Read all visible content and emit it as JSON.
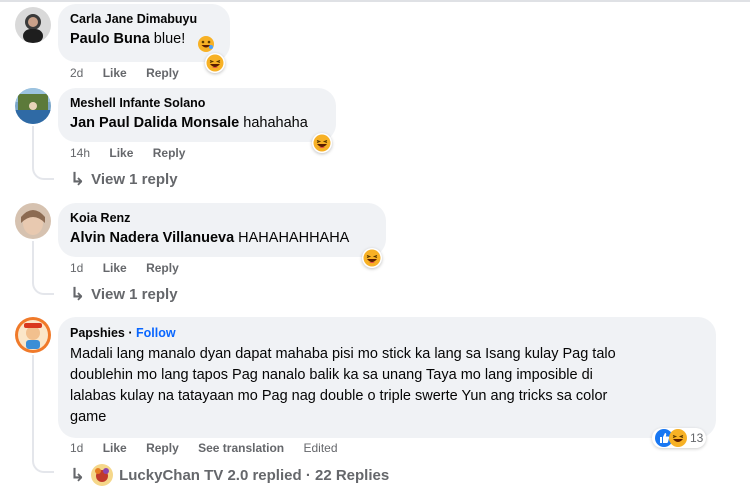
{
  "comments": [
    {
      "author": "Carla Jane Dimabuyu",
      "mention": "Paulo Buna",
      "text": " blue! ",
      "time": "2d",
      "like": "Like",
      "reply": "Reply"
    },
    {
      "author": "Meshell Infante Solano",
      "mention": "Jan Paul Dalida Monsale",
      "text": " hahahaha",
      "time": "14h",
      "like": "Like",
      "reply": "Reply",
      "view_reply": "View 1 reply"
    },
    {
      "author": "Koia Renz",
      "mention": "Alvin Nadera Villanueva",
      "text": " HAHAHAHHAHA",
      "time": "1d",
      "like": "Like",
      "reply": "Reply",
      "view_reply": "View 1 reply"
    },
    {
      "author": "Papshies",
      "dot": " · ",
      "follow": "Follow",
      "text_lines": [
        "Madali lang manalo dyan dapat mahaba pisi mo stick ka lang sa Isang kulay Pag talo",
        "doublehin mo lang tapos Pag nanalo balik ka sa unang Taya mo lang imposible di",
        "lalabas kulay na tatayaan mo Pag nag double o triple swerte Yun ang tricks sa color",
        "game"
      ],
      "time": "1d",
      "like": "Like",
      "reply": "Reply",
      "see_translation": "See translation",
      "edited": "Edited",
      "reaction_count": "13",
      "replied_text": "LuckyChan TV 2.0 replied · 22 Replies"
    }
  ],
  "icons": {
    "reaction": "haha-emoji-icon",
    "like": "like-reaction-icon",
    "reply_arrow": "reply-arrow-icon"
  },
  "colors": {
    "bubble": "#f0f2f5",
    "meta": "#65676b",
    "follow": "#0866ff",
    "haha": "#f7b125"
  }
}
